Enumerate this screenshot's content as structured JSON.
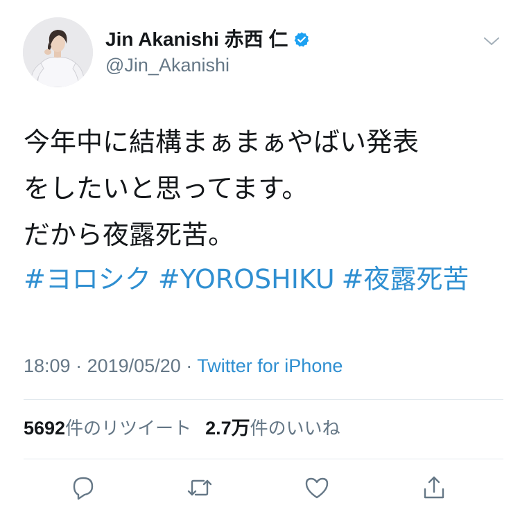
{
  "author": {
    "display_name": "Jin Akanishi  赤西 仁",
    "handle": "@Jin_Akanishi",
    "verified": true
  },
  "tweet": {
    "text_lines": [
      "今年中に結構まぁまぁやばい発表",
      "をしたいと思ってます。",
      "だから夜露死苦。"
    ],
    "hashtags": [
      "#ヨロシク",
      "#YOROSHIKU",
      "#夜露死苦"
    ],
    "time": "18:09",
    "separator": "·",
    "date": "2019/05/20",
    "source": "Twitter for iPhone"
  },
  "stats": {
    "retweets_count": "5692",
    "retweets_label": "件のリツイート",
    "likes_count": "2.7万",
    "likes_label": "件のいいね"
  },
  "actions": {
    "reply_icon": "reply-icon",
    "retweet_icon": "retweet-icon",
    "like_icon": "heart-icon",
    "share_icon": "share-icon"
  },
  "colors": {
    "link": "#2f8fd1",
    "verified": "#1da1f2",
    "muted": "#657786",
    "text": "#14171a",
    "divider": "#e1e8ed"
  }
}
